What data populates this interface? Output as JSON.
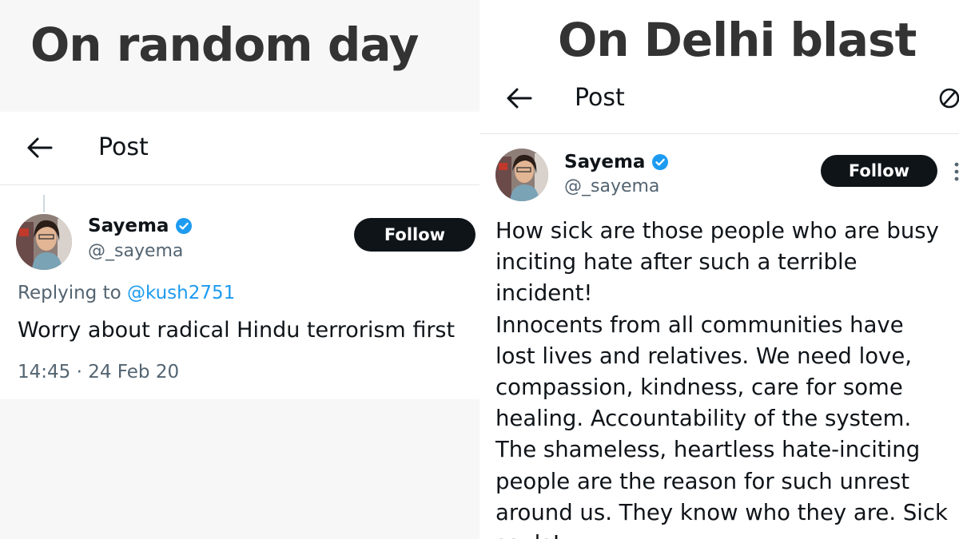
{
  "left": {
    "caption": "On random day",
    "topbar": {
      "title": "Post",
      "back_icon": "arrow-left-icon"
    },
    "author": {
      "name": "Sayema",
      "handle": "@_sayema",
      "verified": true
    },
    "follow_label": "Follow",
    "reply": {
      "prefix": "Replying to ",
      "mention": "@kush2751"
    },
    "text": "Worry about radical Hindu terrorism first",
    "timestamp": "14:45 · 24 Feb 20"
  },
  "right": {
    "caption": "On Delhi blast",
    "topbar": {
      "title": "Post",
      "back_icon": "arrow-left-icon"
    },
    "author": {
      "name": "Sayema",
      "handle": "@_sayema",
      "verified": true
    },
    "follow_label": "Follow",
    "text_lines": [
      "How sick are those people who are busy",
      "inciting hate after such a terrible incident!",
      "Innocents from all communities have",
      "lost lives and relatives. We need love,",
      "compassion, kindness, care for some",
      "healing. Accountability of the system.",
      "The shameless, heartless hate-inciting",
      "people are the reason for such unrest",
      "around us. They know who they are. Sick",
      "souls!"
    ]
  },
  "colors": {
    "verified": "#1d9bf0",
    "mention": "#1d9bf0",
    "follow_button": "#0f1419",
    "secondary_text": "#536471"
  }
}
